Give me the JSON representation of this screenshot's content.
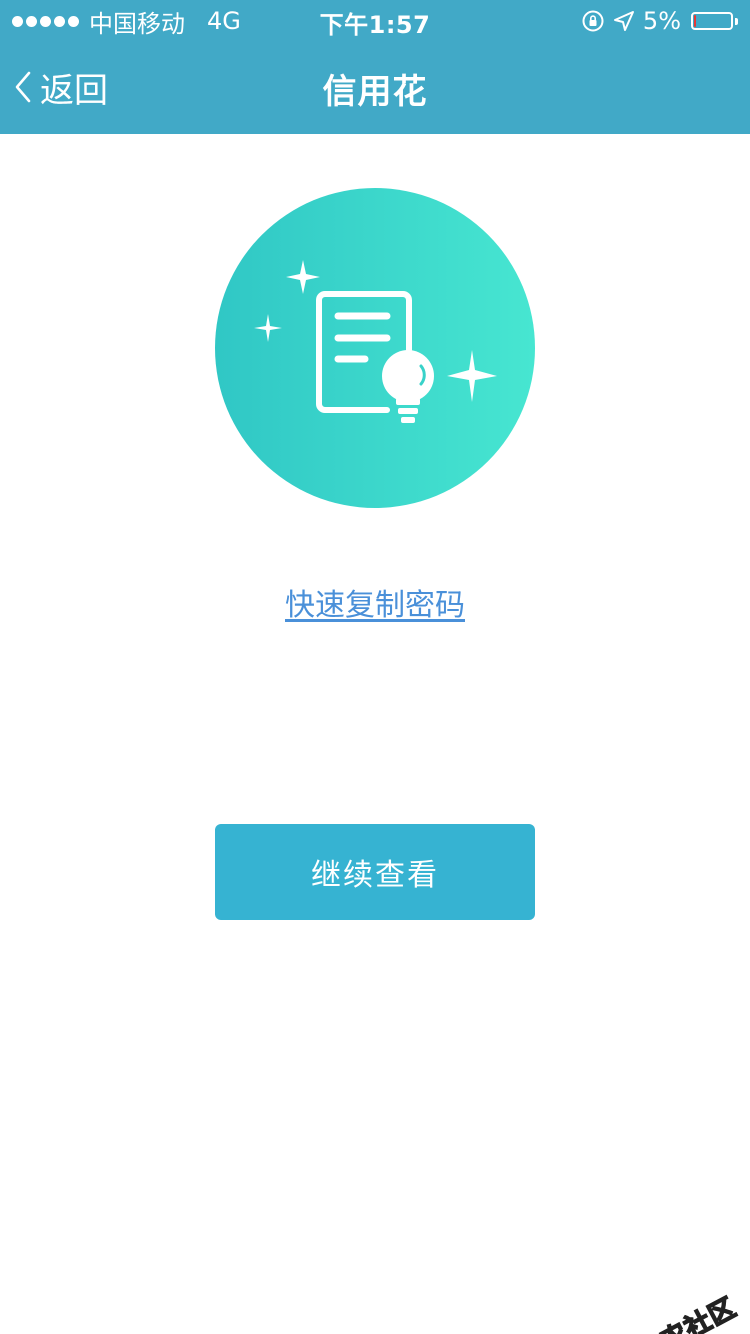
{
  "status_bar": {
    "carrier": "中国移动",
    "network": "4G",
    "time": "下午1:57",
    "battery_percent_label": "5%",
    "battery_level": 0.05,
    "signal_bars_filled": 5
  },
  "nav": {
    "back_label": "返回",
    "title": "信用花"
  },
  "main": {
    "illustration_icon": "document-lightbulb-sparkles-icon",
    "copy_link_label": "快速复制密码",
    "continue_button_label": "继续查看"
  },
  "watermark": {
    "text": "卡农社区"
  },
  "colors": {
    "header_bg": "#41a9c7",
    "circle_gradient_start": "#30c7c5",
    "circle_gradient_end": "#47e6d1",
    "link": "#4a90d9",
    "button_bg": "#36b3d2",
    "battery_low": "#e53935"
  }
}
